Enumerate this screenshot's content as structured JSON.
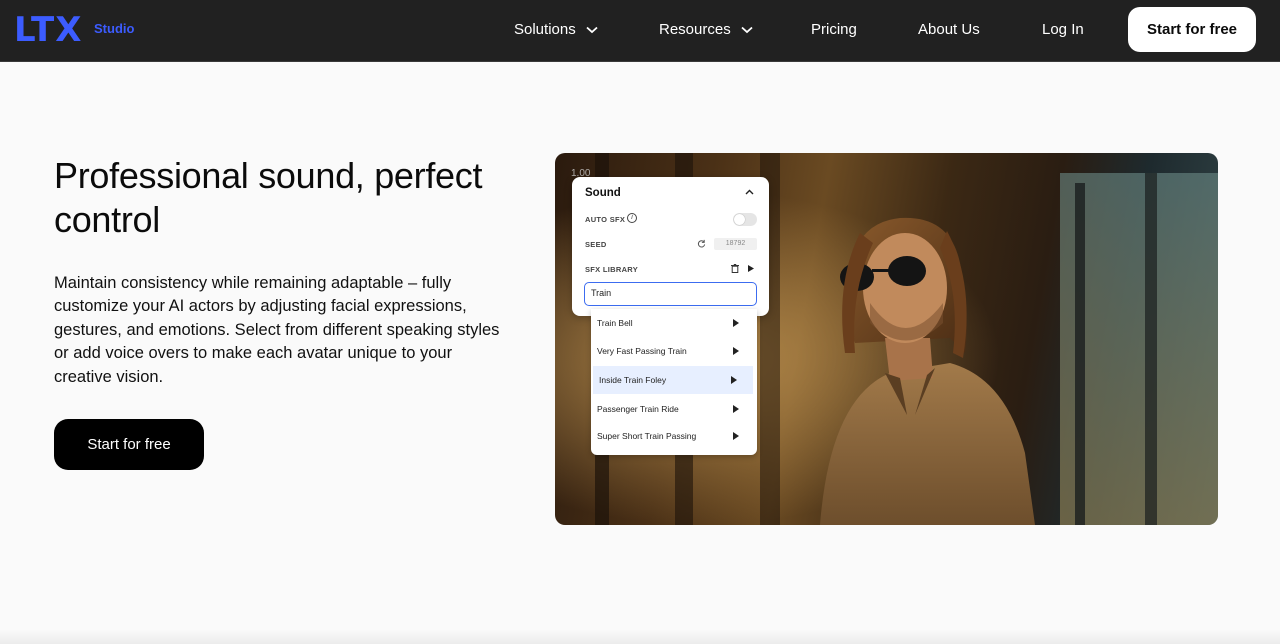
{
  "nav": {
    "logo": {
      "mark": "LTX",
      "sub": "Studio"
    },
    "items": [
      {
        "label": "Solutions",
        "dropdown": true
      },
      {
        "label": "Resources",
        "dropdown": true
      },
      {
        "label": "Pricing"
      },
      {
        "label": "About Us"
      },
      {
        "label": "Log In"
      }
    ],
    "cta": "Start for free"
  },
  "hero": {
    "headline": "Professional sound, perfect control",
    "body": "Maintain consistency while remaining adaptable – fully customize your AI actors by adjusting facial expressions, gestures, and emotions. Select from different speaking styles or add voice overs to make each avatar unique to your creative vision.",
    "cta": "Start for free"
  },
  "media": {
    "timecode": "1.00",
    "sound_panel": {
      "title": "Sound",
      "auto_sfx_label": "AUTO SFX",
      "seed_label": "SEED",
      "seed_value": "18792",
      "sfx_library_label": "SFX LIBRARY",
      "search_value": "Train",
      "results": [
        {
          "label": "Train Bell",
          "active": false
        },
        {
          "label": "Very Fast Passing Train",
          "active": false
        },
        {
          "label": "Inside Train Foley",
          "active": true
        },
        {
          "label": "Passenger Train Ride",
          "active": false
        },
        {
          "label": "Super Short Train Passing",
          "active": false
        }
      ]
    }
  },
  "colors": {
    "nav_bg": "#212121",
    "brand_blue": "#3c5cff",
    "page_bg": "#fafafa",
    "focus_blue": "#3c6cf0",
    "active_row": "#e7efff"
  }
}
